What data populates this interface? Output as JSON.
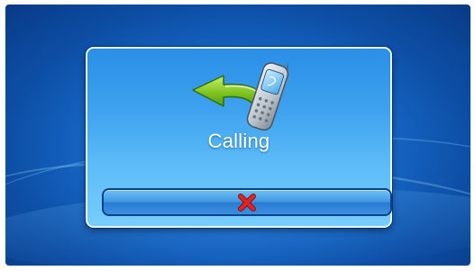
{
  "dialog": {
    "title": "Calling",
    "icon": "call-phone-arrow-icon",
    "cancel_icon": "close-icon"
  },
  "colors": {
    "background": "#1a6fd0",
    "dialog": "#3ea2ef",
    "cancel_x": "#d21f1f",
    "arrow_green": "#7dc21e"
  }
}
